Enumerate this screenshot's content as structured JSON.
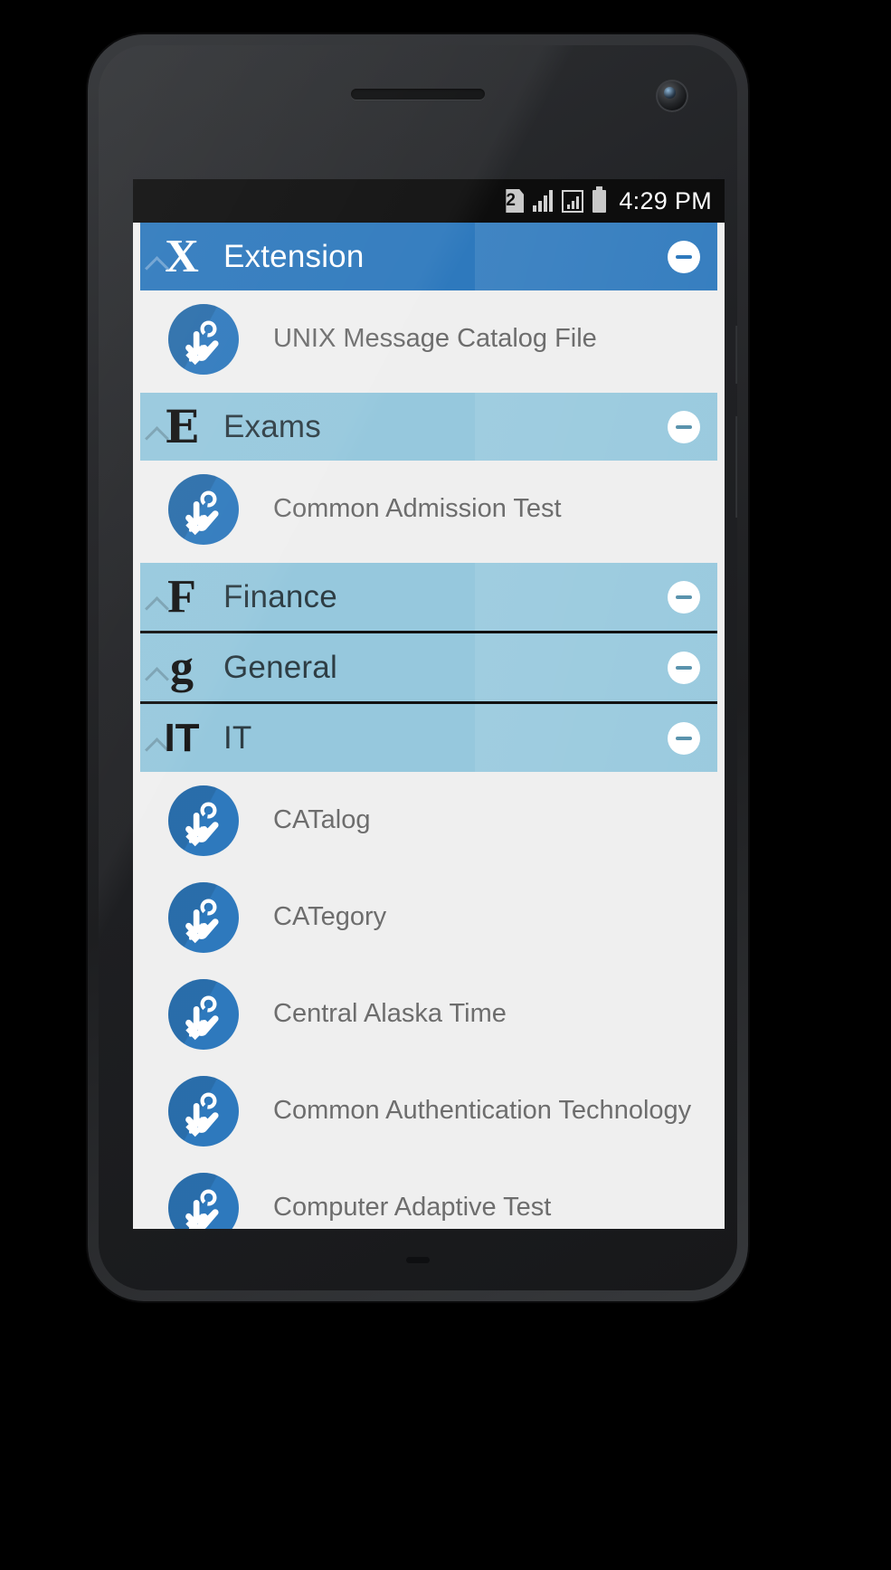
{
  "status_bar": {
    "sim_badge": "2",
    "time": "4:29 PM",
    "icons": [
      "sim-2-icon",
      "signal-bars-icon",
      "signal-bars-boxed-icon",
      "battery-icon"
    ]
  },
  "colors": {
    "accent_blue": "#2e79bd",
    "light_blue": "#96c8dd",
    "screen_background": "#efefef",
    "label_text": "#6d6d6d",
    "header_dark_text": "#2e3d44"
  },
  "groups": [
    {
      "title": "Extension",
      "letter": "X",
      "letter_style": "serif",
      "style": "accent",
      "collapse_label": "collapse",
      "items": [
        {
          "label": "UNIX Message Catalog File"
        }
      ]
    },
    {
      "title": "Exams",
      "letter": "E",
      "letter_style": "fraktur",
      "style": "light",
      "collapse_label": "collapse",
      "items": [
        {
          "label": "Common Admission Test"
        }
      ]
    },
    {
      "title": "Finance",
      "letter": "F",
      "letter_style": "serif",
      "style": "light",
      "collapse_label": "collapse",
      "items": []
    },
    {
      "title": "General",
      "letter": "g",
      "letter_style": "serif",
      "style": "light",
      "collapse_label": "collapse",
      "items": []
    },
    {
      "title": "IT",
      "letter": "IT",
      "letter_style": "sans",
      "style": "light",
      "collapse_label": "collapse",
      "items": [
        {
          "label": "CATalog"
        },
        {
          "label": "CATegory"
        },
        {
          "label": "Central Alaska Time"
        },
        {
          "label": "Common Authentication Technology"
        },
        {
          "label": "Computer Adaptive Test"
        }
      ]
    }
  ]
}
